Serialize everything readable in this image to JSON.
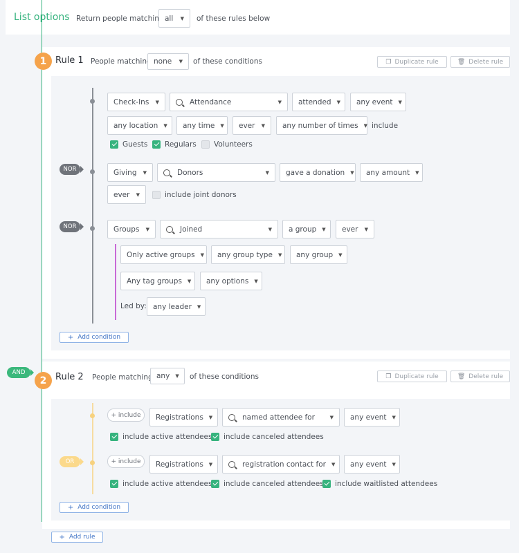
{
  "header": {
    "title": "List options",
    "return_label": "Return people matching",
    "match_value": "all",
    "suffix": "of these rules below"
  },
  "rule1": {
    "number": "1",
    "title": "Rule 1",
    "people_matching": "People matching",
    "match_value": "none",
    "suffix": "of these conditions",
    "duplicate": "Duplicate rule",
    "delete": "Delete rule",
    "checkins": {
      "type": "Check-Ins",
      "search": "Attendance",
      "verb": "attended",
      "event": "any event",
      "location": "any location",
      "time": "any time",
      "ever": "ever",
      "times": "any number of times",
      "include": "include",
      "options": [
        {
          "label": "Guests",
          "checked": true
        },
        {
          "label": "Regulars",
          "checked": true
        },
        {
          "label": "Volunteers",
          "checked": false
        }
      ]
    },
    "giving": {
      "connector": "NOR",
      "type": "Giving",
      "search": "Donors",
      "verb": "gave a donation",
      "amount": "any amount",
      "ever": "ever",
      "joint": "include joint donors",
      "joint_checked": false
    },
    "groups": {
      "connector": "NOR",
      "type": "Groups",
      "search": "Joined",
      "verb": "a group",
      "ever": "ever",
      "active": "Only active groups",
      "group_type": "any group type",
      "group": "any group",
      "tag_groups": "Any tag groups",
      "options": "any options",
      "led_by": "Led by:",
      "leader": "any leader"
    },
    "add_condition": "Add condition"
  },
  "connector_and": "AND",
  "rule2": {
    "number": "2",
    "title": "Rule 2",
    "people_matching": "People matching",
    "match_value": "any",
    "suffix": "of these conditions",
    "duplicate": "Duplicate rule",
    "delete": "Delete rule",
    "reg1": {
      "include": "+ include",
      "type": "Registrations",
      "search": "named attendee for",
      "event": "any event",
      "options": [
        {
          "label": "include active attendees",
          "checked": true
        },
        {
          "label": "include canceled attendees",
          "checked": true
        }
      ]
    },
    "reg2": {
      "connector": "OR",
      "include": "+ include",
      "type": "Registrations",
      "search": "registration contact for",
      "event": "any event",
      "options": [
        {
          "label": "include active attendees",
          "checked": true
        },
        {
          "label": "include canceled attendees",
          "checked": true
        },
        {
          "label": "include waitlisted attendees",
          "checked": true
        }
      ]
    },
    "add_condition": "Add condition"
  },
  "add_rule": "Add rule",
  "icons": {
    "caret": "caret-down-icon",
    "search": "search-icon",
    "duplicate": "duplicate-icon",
    "trash": "trash-icon",
    "plus": "plus-icon"
  },
  "colors": {
    "accent_green": "#36b37e",
    "badge_orange": "#f5a34b",
    "link_blue": "#3f73c6",
    "group_purple": "#c86ad7",
    "or_yellow": "#fbd98b",
    "nor_gray": "#6f737a"
  }
}
